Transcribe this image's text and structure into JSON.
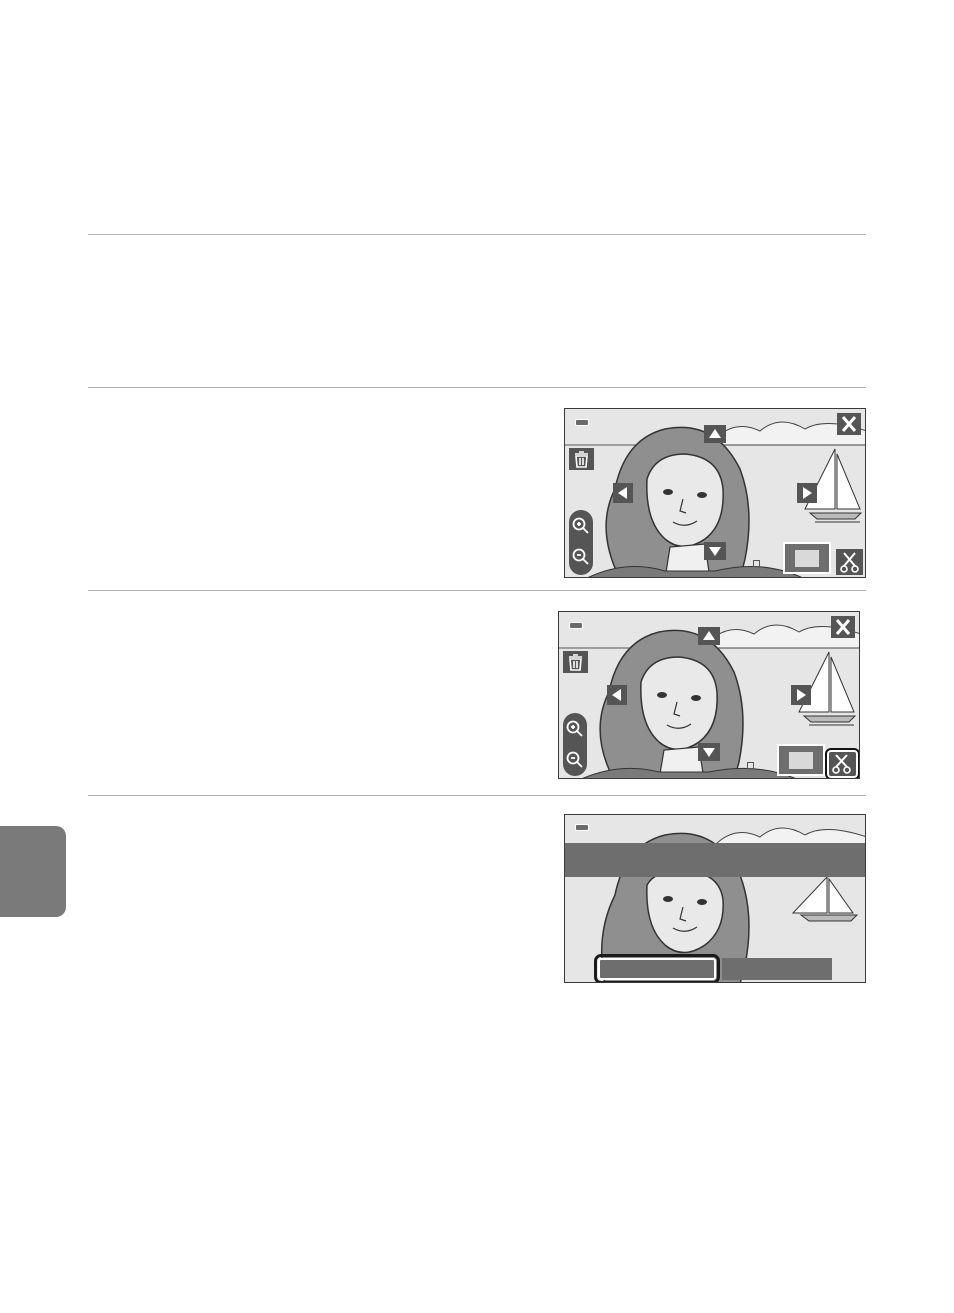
{
  "page": {
    "rules": [
      "rule-1",
      "rule-2",
      "rule-3",
      "rule-4"
    ]
  },
  "screens": [
    {
      "id": "step-1",
      "crop_highlighted": false,
      "icons": [
        "battery-icon",
        "close-icon",
        "delete-icon",
        "zoom-in-icon",
        "zoom-out-icon",
        "arrow-up-icon",
        "arrow-down-icon",
        "arrow-left-icon",
        "arrow-right-icon",
        "crop-frame-icon",
        "crop-scissors-icon"
      ]
    },
    {
      "id": "step-2",
      "crop_highlighted": true,
      "icons": [
        "battery-icon",
        "close-icon",
        "delete-icon",
        "zoom-in-icon",
        "zoom-out-icon",
        "arrow-up-icon",
        "arrow-down-icon",
        "arrow-left-icon",
        "arrow-right-icon",
        "crop-frame-icon",
        "crop-scissors-icon"
      ]
    },
    {
      "id": "step-3",
      "dialog": {
        "banner": "",
        "yes_label": "",
        "no_label": "",
        "selected": "yes"
      }
    }
  ],
  "colors": {
    "screen_bg": "#d9d9d9",
    "hair": "#8f8f8f",
    "button_dark": "#555555",
    "side_tab": "#7a7a7a"
  }
}
